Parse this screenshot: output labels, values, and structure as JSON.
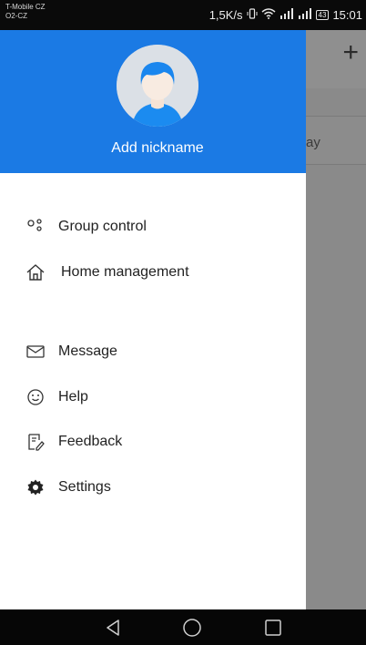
{
  "status_bar": {
    "carrier_line1": "T-Mobile CZ",
    "carrier_line2": "O2-CZ",
    "speed": "1,5K/s",
    "battery": "43",
    "time": "15:01"
  },
  "background_app": {
    "add_icon": "plus-icon",
    "row_text_fragment": "ay"
  },
  "drawer": {
    "header": {
      "avatar_icon": "user-avatar-icon",
      "nickname_label": "Add nickname",
      "color": "#1b7ae4"
    },
    "menu_items": [
      {
        "label": "Group control",
        "icon": "group-control-icon"
      },
      {
        "label": "Home management",
        "icon": "home-icon"
      },
      {
        "label": "Message",
        "icon": "envelope-icon"
      },
      {
        "label": "Help",
        "icon": "smiley-help-icon"
      },
      {
        "label": "Feedback",
        "icon": "feedback-edit-icon"
      },
      {
        "label": "Settings",
        "icon": "gear-icon"
      }
    ]
  },
  "nav_bar": {
    "buttons": [
      "back-triangle-icon",
      "home-circle-icon",
      "recents-square-icon"
    ]
  }
}
